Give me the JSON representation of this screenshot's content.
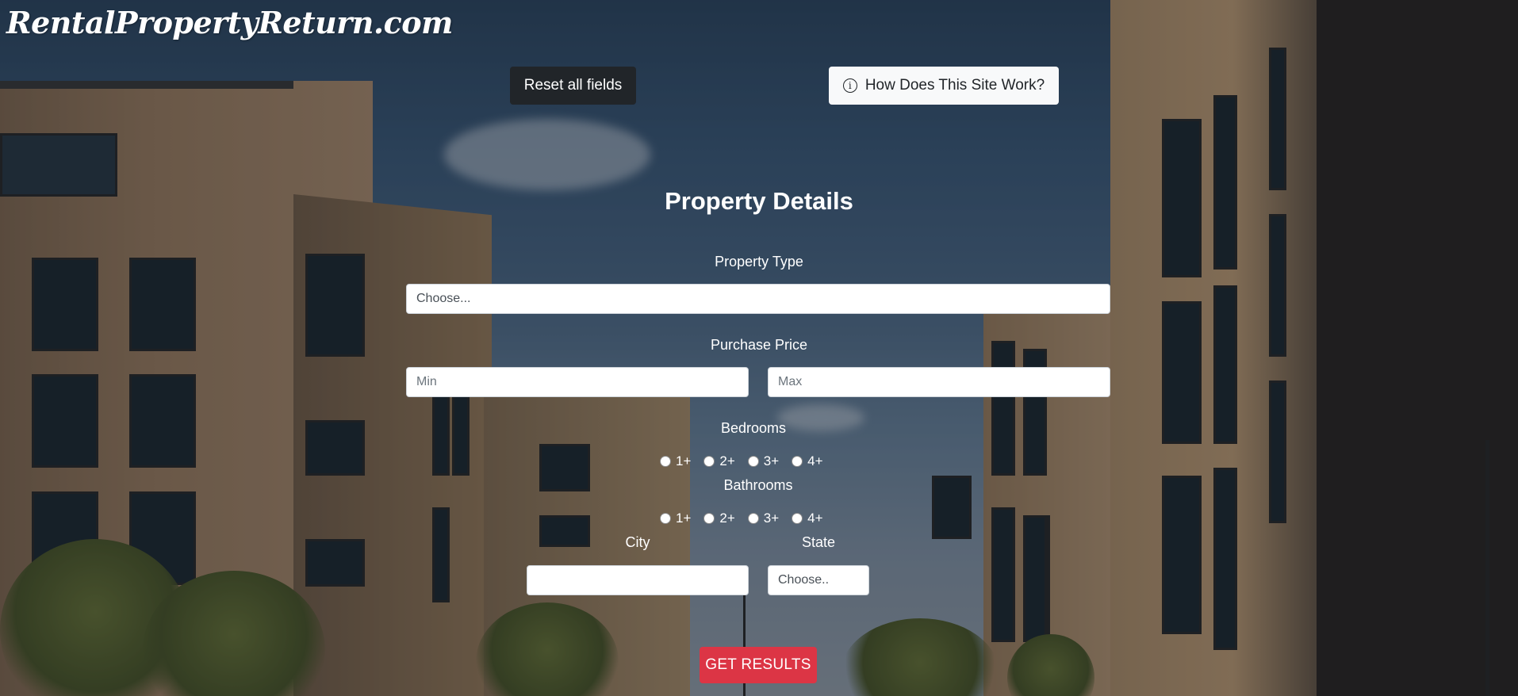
{
  "logo": {
    "text": "RentalPropertyReturn.com"
  },
  "toolbar": {
    "reset_label": "Reset all fields",
    "help_label": "How Does This Site Work?",
    "help_icon": "info-icon"
  },
  "form": {
    "title": "Property Details",
    "property_type": {
      "label": "Property Type",
      "selected": "Choose..."
    },
    "purchase_price": {
      "label": "Purchase Price",
      "min_placeholder": "Min",
      "max_placeholder": "Max"
    },
    "bedrooms": {
      "label": "Bedrooms",
      "options": [
        "1+",
        "2+",
        "3+",
        "4+"
      ]
    },
    "bathrooms": {
      "label": "Bathrooms",
      "options": [
        "1+",
        "2+",
        "3+",
        "4+"
      ]
    },
    "city": {
      "label": "City",
      "value": ""
    },
    "state": {
      "label": "State",
      "selected": "Choose.."
    },
    "submit_label": "GET RESULTS"
  },
  "colors": {
    "reset_button": "#212529",
    "submit_button": "#dc3545",
    "help_button": "#f8f9fa"
  }
}
